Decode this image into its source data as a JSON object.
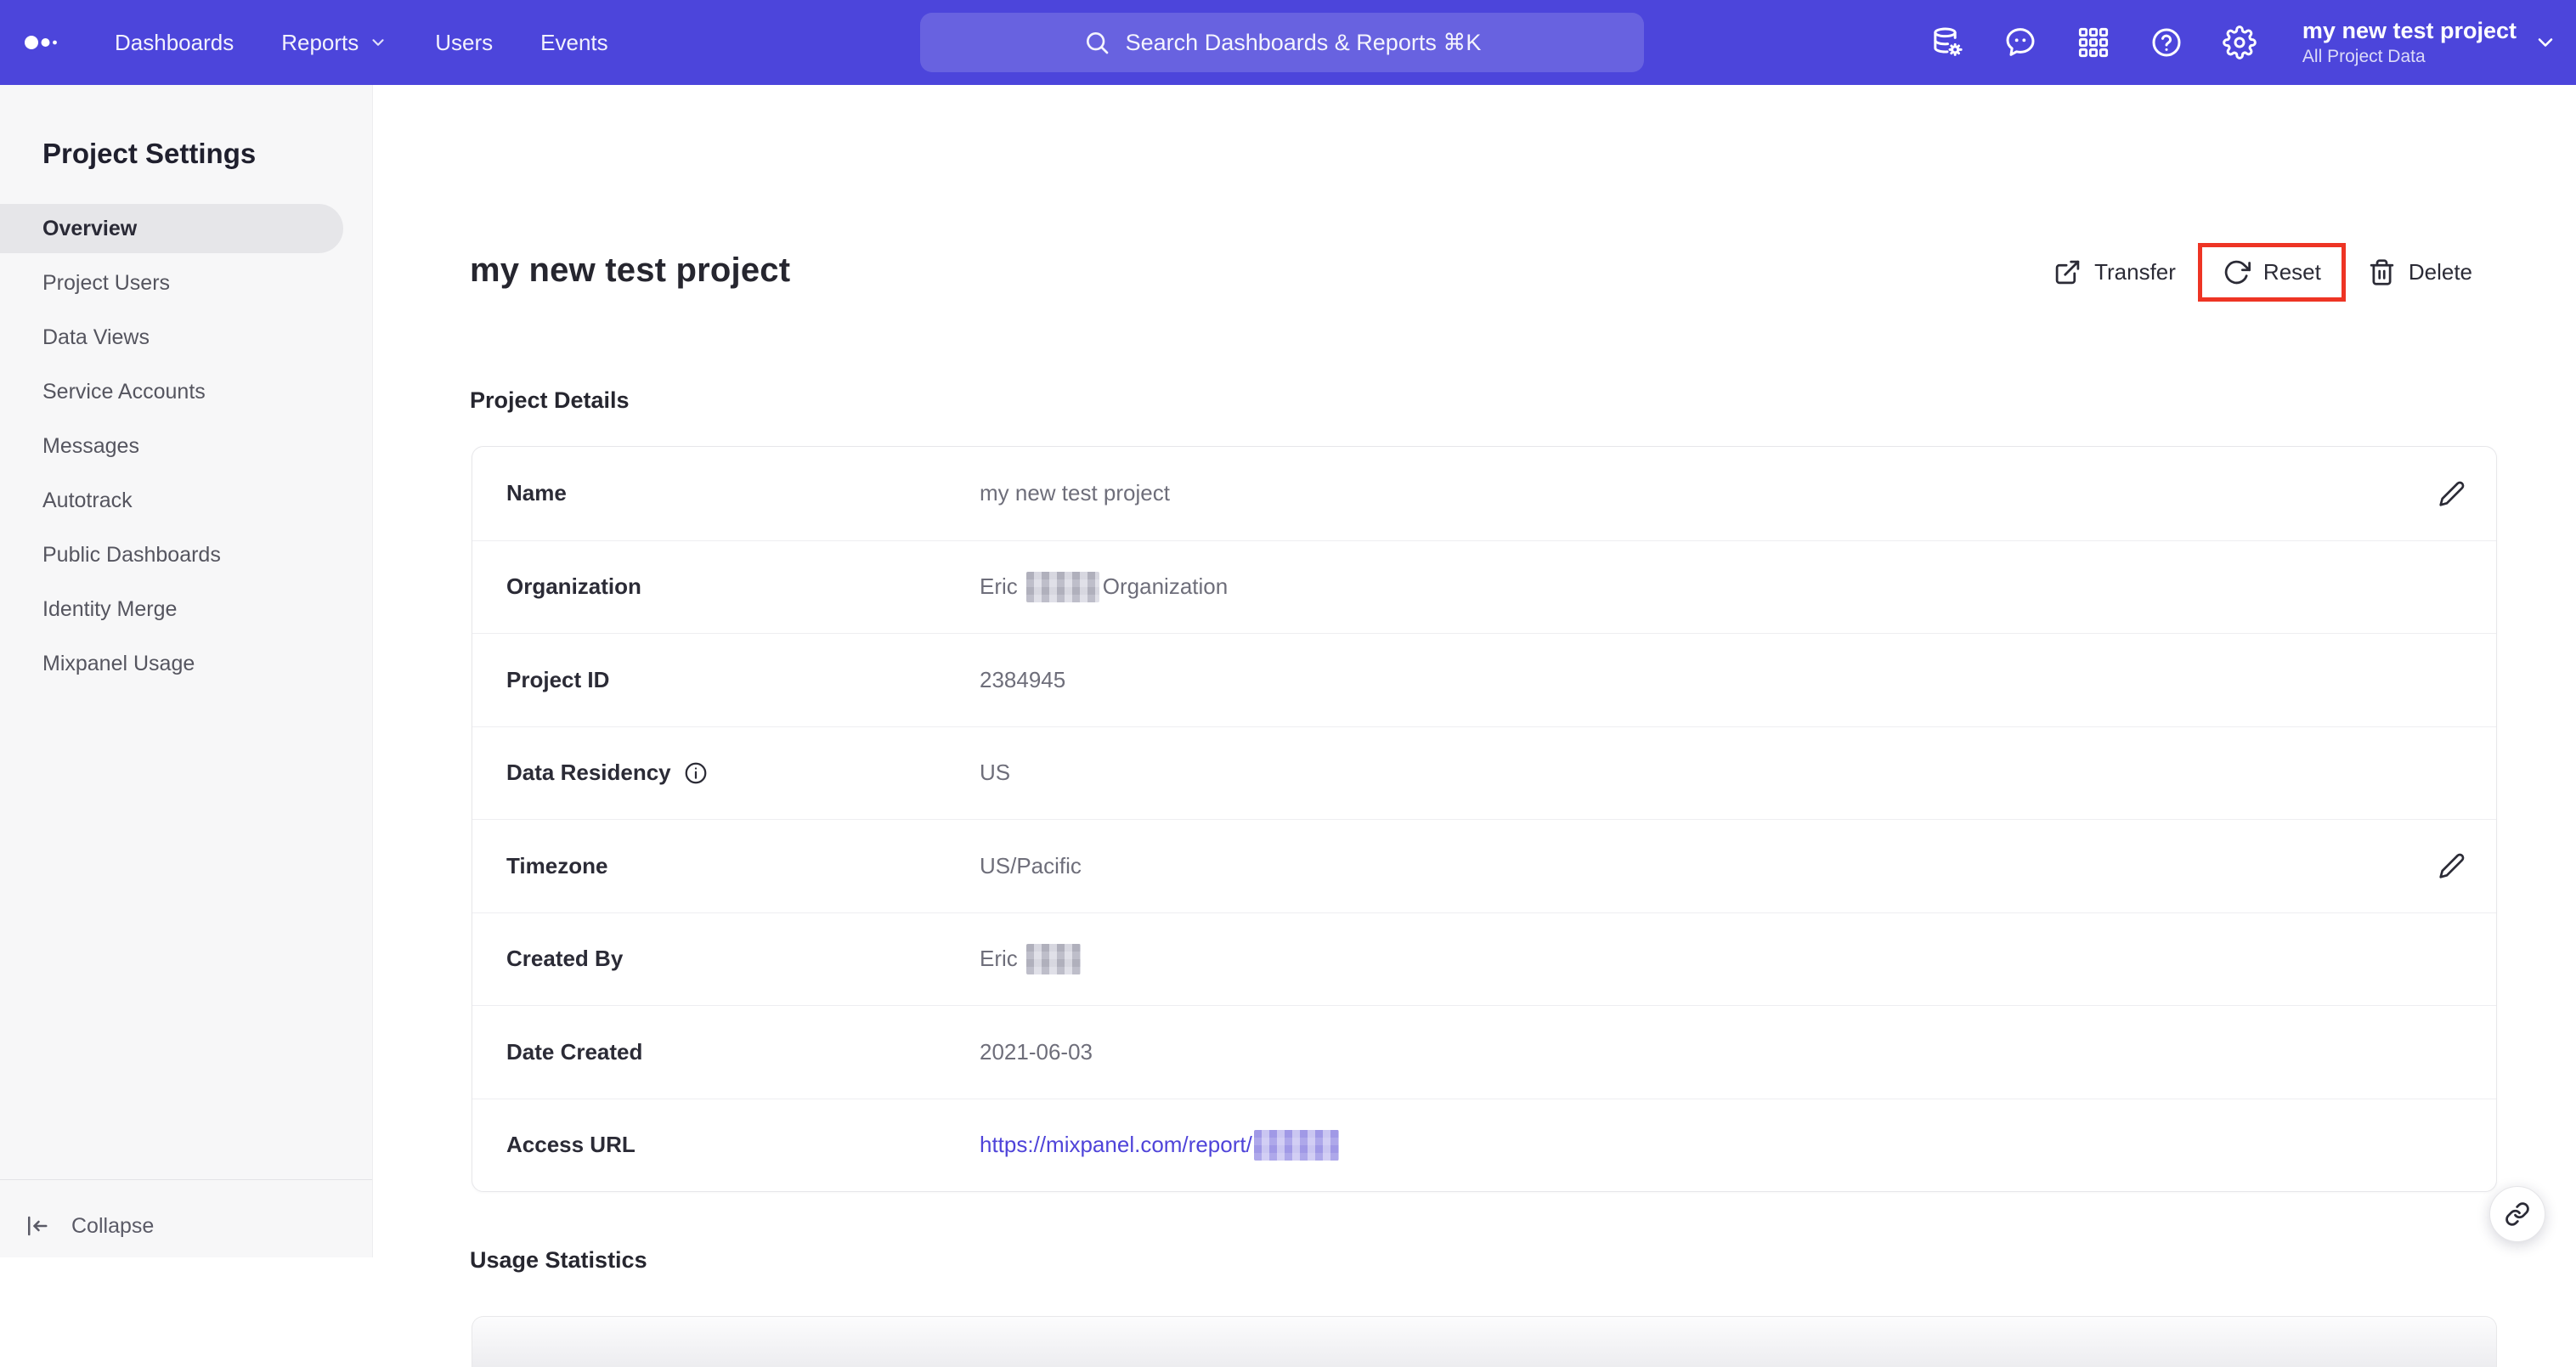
{
  "topbar": {
    "nav": [
      {
        "label": "Dashboards"
      },
      {
        "label": "Reports"
      },
      {
        "label": "Users"
      },
      {
        "label": "Events"
      }
    ],
    "search_placeholder": "Search Dashboards & Reports ⌘K",
    "icons": [
      "data-management",
      "feedback",
      "apps-grid",
      "help",
      "settings"
    ],
    "project_switcher": {
      "name": "my new test project",
      "scope": "All Project Data"
    }
  },
  "sidebar": {
    "title": "Project Settings",
    "items": [
      {
        "label": "Overview",
        "active": true
      },
      {
        "label": "Project Users"
      },
      {
        "label": "Data Views"
      },
      {
        "label": "Service Accounts"
      },
      {
        "label": "Messages"
      },
      {
        "label": "Autotrack"
      },
      {
        "label": "Public Dashboards"
      },
      {
        "label": "Identity Merge"
      },
      {
        "label": "Mixpanel Usage"
      }
    ],
    "collapse_label": "Collapse"
  },
  "main": {
    "title": "my new test project",
    "actions": {
      "transfer": "Transfer",
      "reset": "Reset",
      "delete": "Delete"
    },
    "sections": {
      "details": "Project Details",
      "usage": "Usage Statistics"
    },
    "details_rows": [
      {
        "label": "Name",
        "value": "my new test project",
        "editable": true
      },
      {
        "label": "Organization",
        "value_prefix": "Eric",
        "value_suffix": "Organization",
        "redacted": true
      },
      {
        "label": "Project ID",
        "value": "2384945"
      },
      {
        "label": "Data Residency",
        "value": "US",
        "info": true
      },
      {
        "label": "Timezone",
        "value": "US/Pacific",
        "editable": true
      },
      {
        "label": "Created By",
        "value_prefix": "Eric",
        "redacted": true
      },
      {
        "label": "Date Created",
        "value": "2021-06-03"
      },
      {
        "label": "Access URL",
        "link_text": "https://mixpanel.com/report/",
        "redacted": true
      }
    ]
  },
  "annotation": {
    "target": "reset-button",
    "color": "#ee3424"
  },
  "colors": {
    "topbar_bg": "#4c45db",
    "link": "#4f44d9",
    "sidebar_bg": "#f7f7f8",
    "active_item_bg": "#e6e6e9",
    "annotation_red": "#ee3424"
  }
}
